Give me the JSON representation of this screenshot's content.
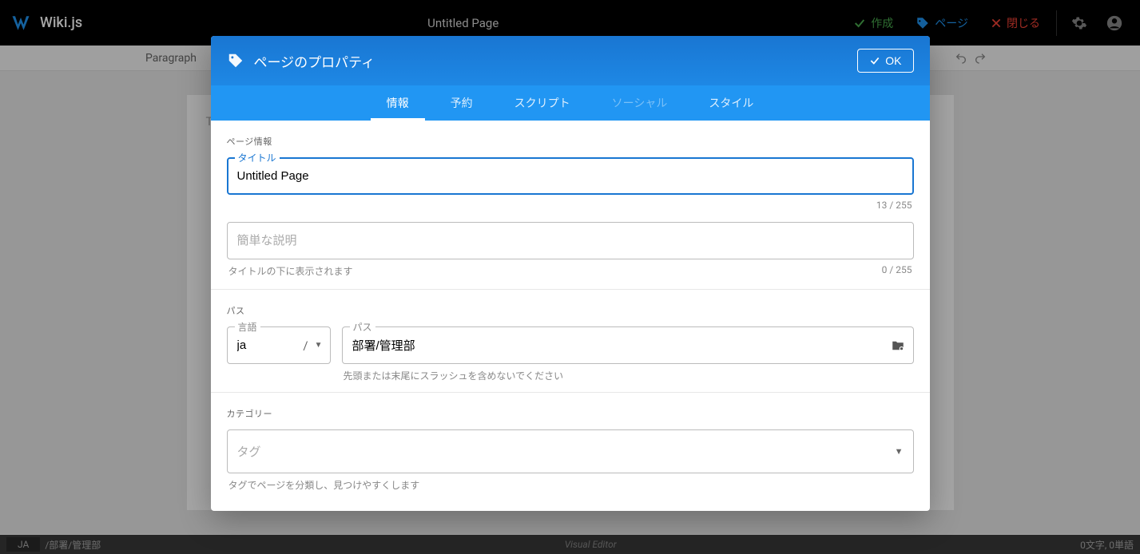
{
  "app": {
    "name": "Wiki.js",
    "page_title": "Untitled Page"
  },
  "topbar": {
    "create": "作成",
    "page": "ページ",
    "close": "閉じる"
  },
  "toolbar": {
    "paragraph": "Paragraph"
  },
  "editor": {
    "placeholder": "Type"
  },
  "statusbar": {
    "lang": "JA",
    "path": "/部署/管理部",
    "mode": "Visual Editor",
    "stats": "0文字, 0単語"
  },
  "dialog": {
    "title": "ページのプロパティ",
    "ok": "OK",
    "tabs": {
      "info": "情報",
      "schedule": "予約",
      "script": "スクリプト",
      "social": "ソーシャル",
      "style": "スタイル"
    },
    "section_info": "ページ情報",
    "title_field": {
      "label": "タイトル",
      "value": "Untitled Page",
      "counter": "13 / 255"
    },
    "desc_field": {
      "placeholder": "簡単な説明",
      "hint": "タイトルの下に表示されます",
      "counter": "0 / 255"
    },
    "section_path": "パス",
    "lang_field": {
      "label": "言語",
      "value": "ja"
    },
    "path_field": {
      "label": "パス",
      "value": "部署/管理部",
      "hint": "先頭または末尾にスラッシュを含めないでください"
    },
    "section_category": "カテゴリー",
    "tag_field": {
      "placeholder": "タグ",
      "hint": "タグでページを分類し、見つけやすくします"
    }
  }
}
